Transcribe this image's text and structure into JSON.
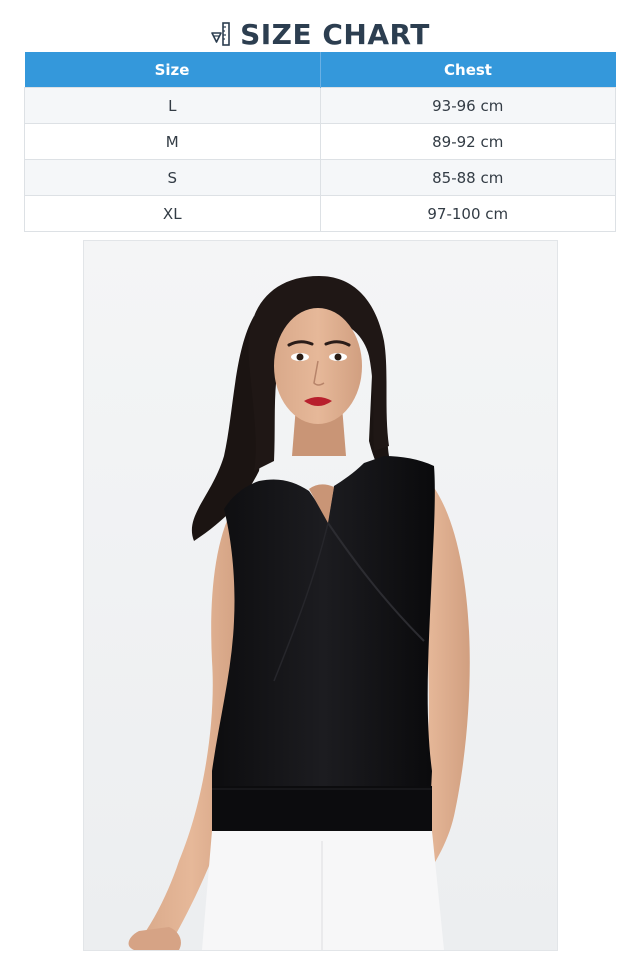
{
  "header": {
    "icon": "ruler-pencil-icon",
    "title": "SIZE CHART"
  },
  "size_table": {
    "columns": [
      "Size",
      "Chest"
    ],
    "rows": [
      {
        "size": "L",
        "chest": "93-96 cm"
      },
      {
        "size": "M",
        "chest": "89-92 cm"
      },
      {
        "size": "S",
        "chest": "85-88 cm"
      },
      {
        "size": "XL",
        "chest": "97-100 cm"
      }
    ]
  },
  "colors": {
    "header_bg": "#3498db",
    "title_text": "#2c3e50",
    "row_alt": "#f5f7f9"
  },
  "product_photo": {
    "subject": "model wearing black sleeveless wrap top"
  }
}
